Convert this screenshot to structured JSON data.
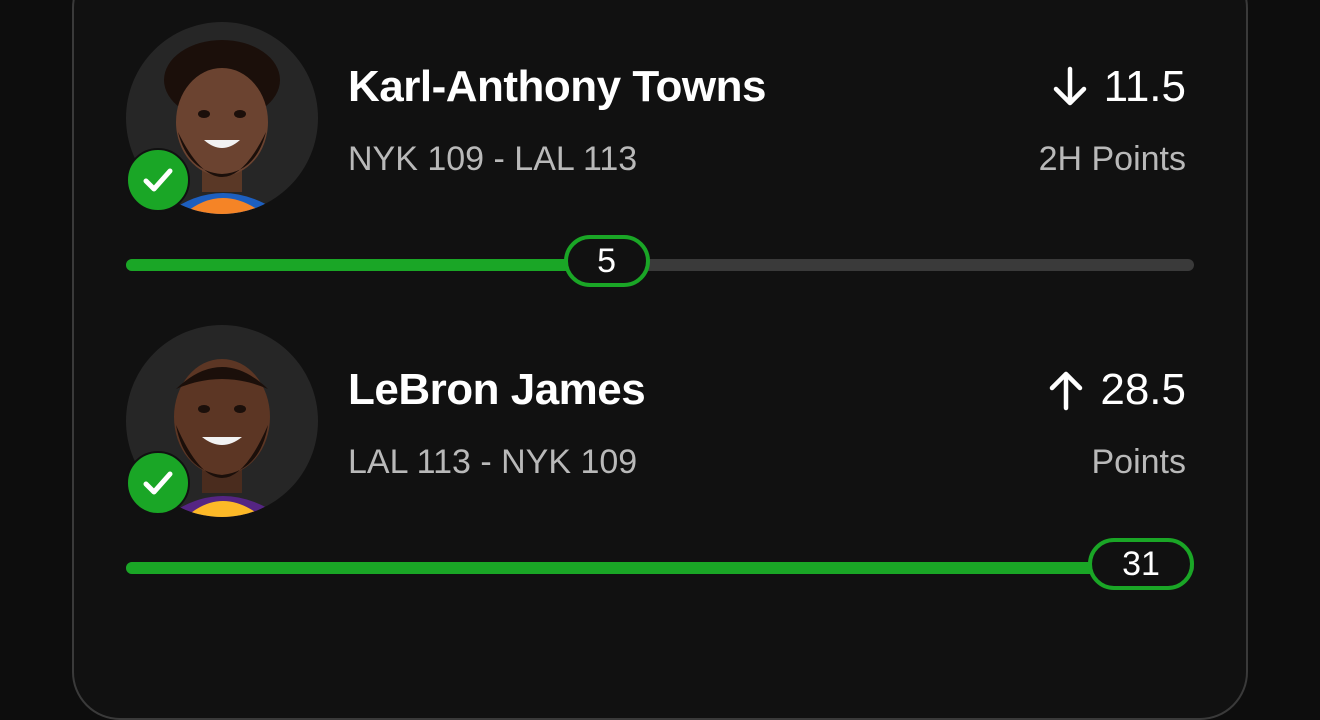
{
  "colors": {
    "accent": "#1aa626",
    "track": "#3a3a3a",
    "background": "#111111",
    "muted_text": "#b9b9b9"
  },
  "props": [
    {
      "player": "Karl-Anthony Towns",
      "matchup": "NYK 109  - LAL 113",
      "direction_icon": "arrow-down-icon",
      "line": "11.5",
      "stat": "2H Points",
      "actual": "5",
      "progress": 0.45,
      "status_icon": "check-icon"
    },
    {
      "player": "LeBron James",
      "matchup": "LAL 113  - NYK 109",
      "direction_icon": "arrow-up-icon",
      "line": "28.5",
      "stat": "Points",
      "actual": "31",
      "progress": 1.0,
      "status_icon": "check-icon"
    }
  ]
}
